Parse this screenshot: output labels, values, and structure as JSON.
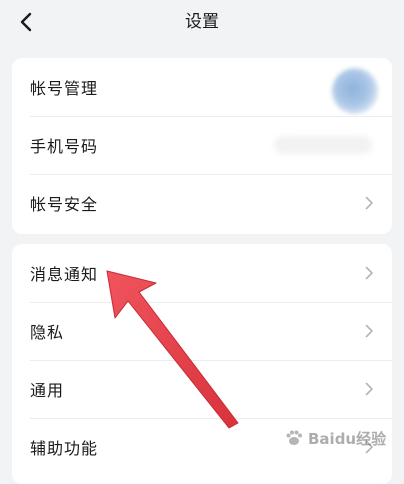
{
  "header": {
    "title": "设置",
    "back_icon": "chevron-left-icon"
  },
  "groups": [
    {
      "items": [
        {
          "label": "帐号管理",
          "trailing": "avatar"
        },
        {
          "label": "手机号码",
          "trailing": "masked-value"
        },
        {
          "label": "帐号安全",
          "trailing": "chevron-right-icon"
        }
      ]
    },
    {
      "items": [
        {
          "label": "消息通知",
          "trailing": "chevron-right-icon"
        },
        {
          "label": "隐私",
          "trailing": "chevron-right-icon"
        },
        {
          "label": "通用",
          "trailing": "chevron-right-icon"
        },
        {
          "label": "辅助功能",
          "trailing": "chevron-right-icon"
        }
      ]
    }
  ],
  "annotation": {
    "type": "arrow",
    "color": "#e8404a",
    "points_to": "消息通知"
  },
  "watermark": {
    "text": "Baidu经验"
  },
  "colors": {
    "background": "#f2f3f5",
    "card": "#ffffff",
    "text": "#1a1a1a",
    "chevron": "#b5b5b5"
  }
}
